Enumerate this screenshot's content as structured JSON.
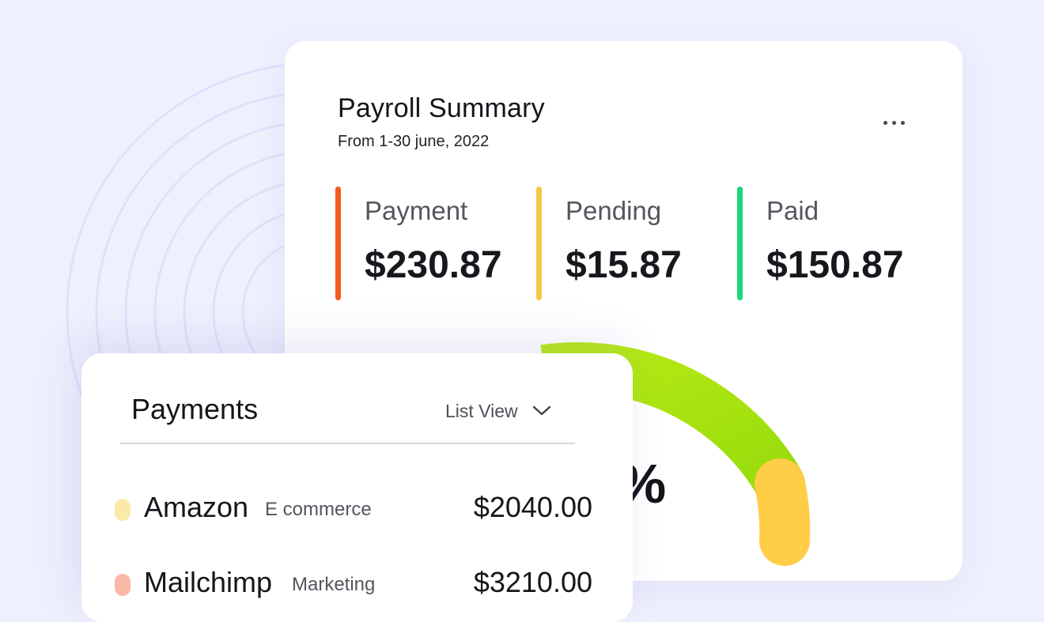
{
  "colors": {
    "background": "#eef0fd",
    "payment_accent": "#f25b1e",
    "pending_accent": "#f7c844",
    "paid_accent": "#1ed67e",
    "gauge_green": "#a6e30f",
    "gauge_yellow": "#ffcd46"
  },
  "summary": {
    "title": "Payroll Summary",
    "subtitle": "From 1-30 june, 2022",
    "more_icon": "more-horizontal-icon",
    "stats": [
      {
        "label": "Payment",
        "value": "$230.87",
        "color": "#f25b1e"
      },
      {
        "label": "Pending",
        "value": "$15.87",
        "color": "#f7c844"
      },
      {
        "label": "Paid",
        "value": "$150.87",
        "color": "#1ed67e"
      }
    ],
    "gauge_percent_text": "%"
  },
  "payments": {
    "title": "Payments",
    "view_label": "List View",
    "view_icon": "chevron-down-icon",
    "rows": [
      {
        "name": "Amazon",
        "category": "E commerce",
        "amount": "$2040.00",
        "color": "#fbe9a9"
      },
      {
        "name": "Mailchimp",
        "category": "Marketing",
        "amount": "$3210.00",
        "color": "#f9b9a7"
      }
    ]
  }
}
